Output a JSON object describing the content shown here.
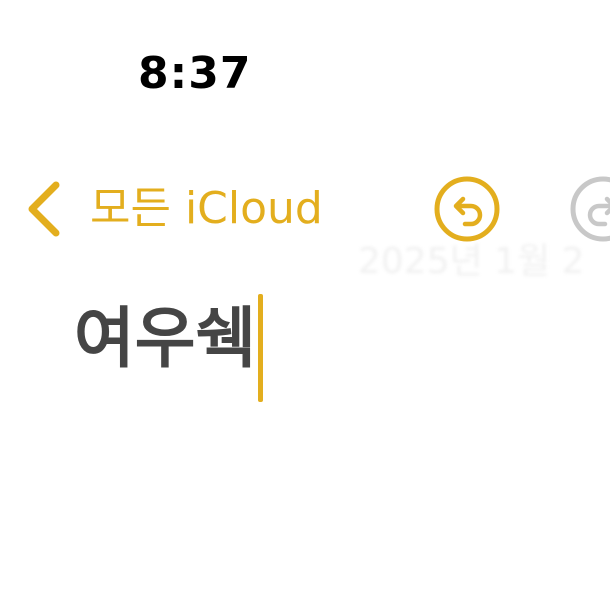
{
  "status_bar": {
    "time": "8:37"
  },
  "nav": {
    "back_label": "모든 iCloud",
    "back_icon": "chevron-left-icon",
    "undo_icon": "undo-icon",
    "redo_icon": "redo-icon",
    "accent_color": "#e3ae1e",
    "disabled_color": "#c8c8c8"
  },
  "note": {
    "timestamp": "2025년 1월 2",
    "body_text": "여우쉑"
  }
}
